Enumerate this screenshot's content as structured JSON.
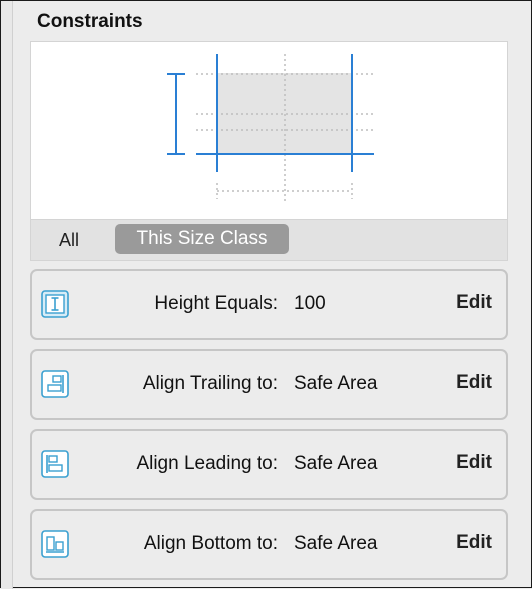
{
  "panel": {
    "title": "Constraints",
    "accent_color": "#2a7fd4",
    "size_class": {
      "all_label": "All",
      "this_size_class_label": "This Size Class",
      "selected": "This Size Class"
    },
    "constraints": [
      {
        "icon": "height-constraint-icon",
        "label": "Height Equals:",
        "value": "100",
        "action": "Edit"
      },
      {
        "icon": "align-trailing-icon",
        "label": "Align Trailing to:",
        "value": "Safe Area",
        "action": "Edit"
      },
      {
        "icon": "align-leading-icon",
        "label": "Align Leading to:",
        "value": "Safe Area",
        "action": "Edit"
      },
      {
        "icon": "align-bottom-icon",
        "label": "Align Bottom to:",
        "value": "Safe Area",
        "action": "Edit"
      }
    ]
  }
}
